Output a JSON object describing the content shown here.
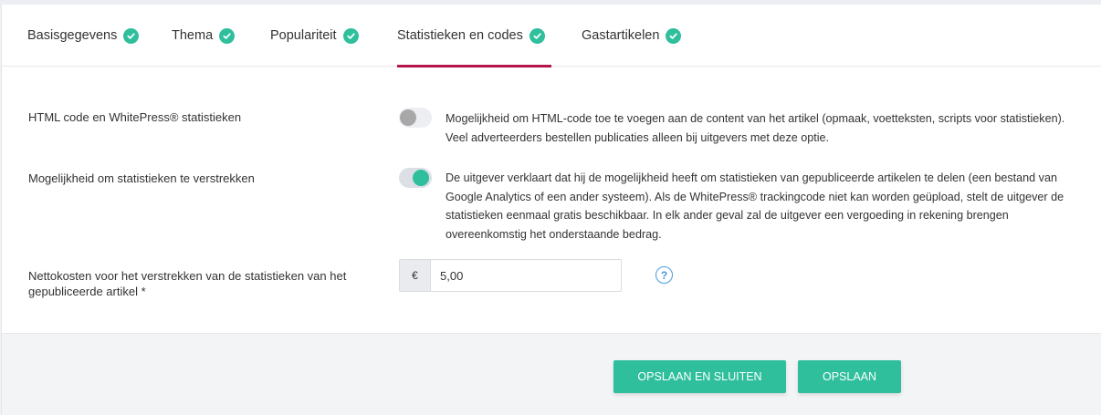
{
  "tabs": [
    {
      "label": "Basisgegevens",
      "completed": true,
      "active": false
    },
    {
      "label": "Thema",
      "completed": true,
      "active": false
    },
    {
      "label": "Populariteit",
      "completed": true,
      "active": false
    },
    {
      "label": "Statistieken en codes",
      "completed": true,
      "active": true
    },
    {
      "label": "Gastartikelen",
      "completed": true,
      "active": false
    }
  ],
  "colors": {
    "accent": "#2fbf9d",
    "active_tab_underline": "#b5154b",
    "help_icon": "#4a9ad6"
  },
  "settings": {
    "html_code": {
      "label": "HTML code en WhitePress® statistieken",
      "enabled": false,
      "description": "Mogelijkheid om HTML-code toe te voegen aan de content van het artikel (opmaak, voetteksten, scripts voor statistieken). Veel adverteerders bestellen publicaties alleen bij uitgevers met deze optie."
    },
    "statistics": {
      "label": "Mogelijkheid om statistieken te verstrekken",
      "enabled": true,
      "description": "De uitgever verklaart dat hij de mogelijkheid heeft om statistieken van gepubliceerde artikelen te delen (een bestand van Google Analytics of een ander systeem). Als de WhitePress® trackingcode niet kan worden geüpload, stelt de uitgever de statistieken eenmaal gratis beschikbaar. In elk ander geval zal de uitgever een vergoeding in rekening brengen overeenkomstig het onderstaande bedrag."
    },
    "net_cost": {
      "label": "Nettokosten voor het verstrekken van de statistieken van het gepubliceerde artikel *",
      "currency": "€",
      "value": "5,00",
      "help_icon": "?"
    }
  },
  "footer": {
    "save_close_label": "OPSLAAN EN SLUITEN",
    "save_label": "OPSLAAN"
  }
}
